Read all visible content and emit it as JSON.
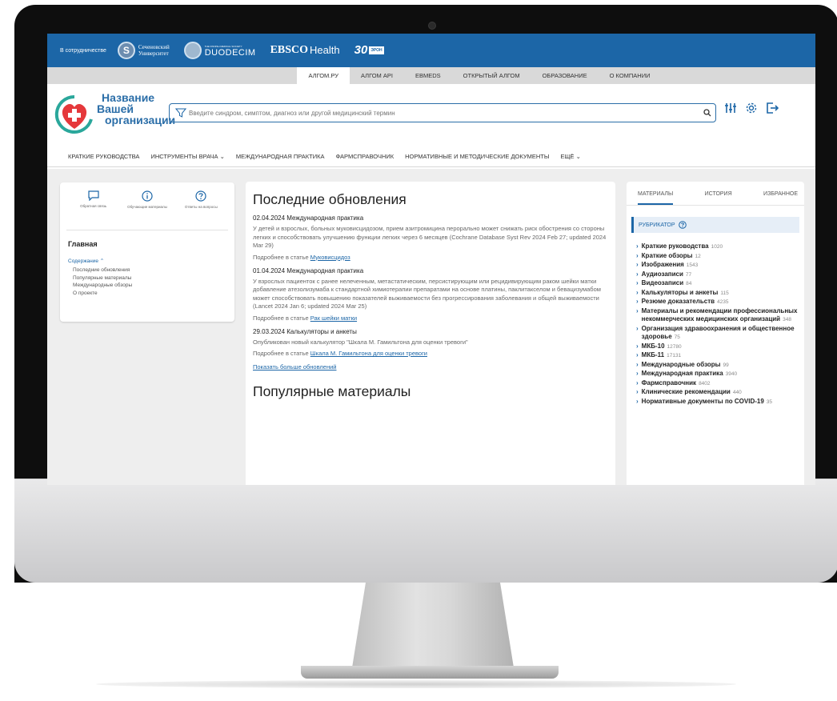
{
  "partners": {
    "label": "В сотрудничестве",
    "sechenov_line1": "Сеченовский",
    "sechenov_line2": "Университет",
    "duodecim_small": "THE FINNISH MEDICAL SOCIETY",
    "duodecim": "DUODECIM",
    "ebsco": "EBSCO",
    "ebsco_health": "Health",
    "thirty": "30",
    "thirty_tag": "ЭРОН"
  },
  "top_nav": [
    "АЛГОМ.РУ",
    "АЛГОМ API",
    "EBMEDS",
    "ОТКРЫТЫЙ АЛГОМ",
    "ОБРАЗОВАНИЕ",
    "О КОМПАНИИ"
  ],
  "org": {
    "line1": "Название",
    "line2": "Вашей",
    "line3": "организации"
  },
  "search": {
    "placeholder": "Введите синдром, симптом, диагноз или другой медицинский термин"
  },
  "main_nav": [
    "КРАТКИЕ РУКОВОДСТВА",
    "ИНСТРУМЕНТЫ ВРАЧА ⌄",
    "МЕЖДУНАРОДНАЯ ПРАКТИКА",
    "ФАРМСПРАВОЧНИК",
    "НОРМАТИВНЫЕ И МЕТОДИЧЕСКИЕ ДОКУМЕНТЫ",
    "ЕЩЁ ⌄"
  ],
  "left": {
    "quick": [
      {
        "icon": "chat-icon",
        "text": "Обратная связь"
      },
      {
        "icon": "info-icon",
        "text": "Обучающие материалы"
      },
      {
        "icon": "question-icon",
        "text": "Ответы на вопросы"
      }
    ],
    "title": "Главная",
    "toc_head": "Содержание ⌃",
    "toc": [
      "Последние обновления",
      "Популярные материалы",
      "Международные обзоры",
      "О проекте"
    ]
  },
  "middle": {
    "title": "Последние обновления",
    "updates": [
      {
        "date": "02.04.2024 Международная практика",
        "text": "У детей и взрослых, больных муковисцидозом, прием азитромицина перорально может снижать риск обострения со стороны легких и способствовать улучшению функции легких через 6 месяцев (Cochrane Database Syst Rev 2024 Feb 27; updated 2024 Mar 29)",
        "more_prefix": "Подробнее в статье ",
        "more_link": "Муковисцидоз"
      },
      {
        "date": "01.04.2024 Международная практика",
        "text": "У взрослых пациенток с ранее нелеченным, метастатическим, персистирующим или рецидивирующим раком шейки матки добавление атезолизумаба к стандартной химиотерапии препаратами на основе платины, паклитакселом и бевацизумабом может способствовать повышению показателей выживаемости без прогрессирования заболевания и общей выживаемости (Lancet 2024 Jan 6; updated 2024 Mar 25)",
        "more_prefix": "Подробнее в статье ",
        "more_link": "Рак шейки матки"
      },
      {
        "date": "29.03.2024 Калькуляторы и анкеты",
        "text": "Опубликован новый калькулятор \"Шкала М. Гамильтона для оценки тревоги\"",
        "more_prefix": "Подробнее в статье ",
        "more_link": "Шкала М. Гамильтона для оценки тревоги"
      }
    ],
    "show_more": "Показать больше обновлений",
    "popular_title": "Популярные материалы"
  },
  "right": {
    "tabs": [
      "МАТЕРИАЛЫ",
      "ИСТОРИЯ",
      "ИЗБРАННОЕ"
    ],
    "rubricator": "РУБРИКАТОР",
    "items": [
      {
        "label": "Краткие руководства",
        "count": "1020"
      },
      {
        "label": "Краткие обзоры",
        "count": "12"
      },
      {
        "label": "Изображения",
        "count": "1543"
      },
      {
        "label": "Аудиозаписи",
        "count": "77"
      },
      {
        "label": "Видеозаписи",
        "count": "84"
      },
      {
        "label": "Калькуляторы и анкеты",
        "count": "115"
      },
      {
        "label": "Резюме доказательств",
        "count": "4235"
      },
      {
        "label": "Материалы и рекомендации профессиональных некоммерческих медицинских организаций",
        "count": "348"
      },
      {
        "label": "Организация здравоохранения и общественное здоровье",
        "count": "75"
      },
      {
        "label": "МКБ-10",
        "count": "12780"
      },
      {
        "label": "МКБ-11",
        "count": "17131"
      },
      {
        "label": "Международные обзоры",
        "count": "99"
      },
      {
        "label": "Международная практика",
        "count": "3940"
      },
      {
        "label": "Фармсправочник",
        "count": "8402"
      },
      {
        "label": "Клинические рекомендации",
        "count": "440"
      },
      {
        "label": "Нормативные документы по COVID-19",
        "count": "35"
      }
    ]
  },
  "colors": {
    "brand": "#1c66a7",
    "logo_red": "#e5383b",
    "logo_teal": "#2aa79b"
  }
}
